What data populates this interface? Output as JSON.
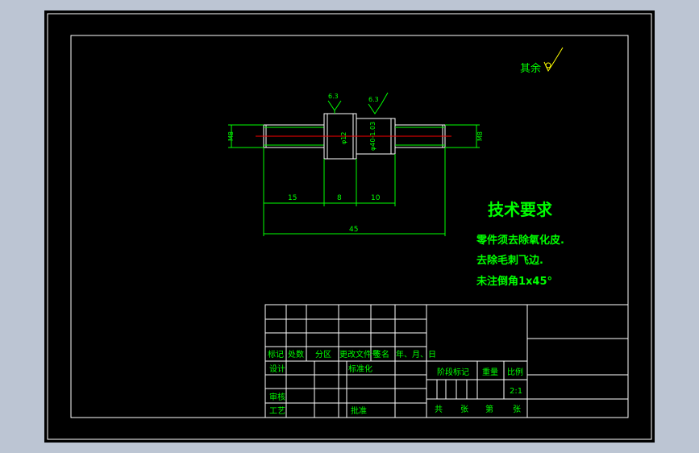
{
  "colors": {
    "background": "#bcc5d3",
    "sheet": "#000000",
    "lines": "#ffffff",
    "text": "#00ff00",
    "dims": "#00ff00",
    "centerline": "#ff0000",
    "roughness": "#ffff00"
  },
  "roughness_default": {
    "label": "其余"
  },
  "roughness_marks": [
    "6.3",
    "6.3"
  ],
  "part_labels": {
    "left_thread": "M8",
    "right_thread": "M8",
    "collar_dia": "φ12",
    "neck_dia": "φ40-1.03"
  },
  "dimensions": {
    "d1": "15",
    "d2": "8",
    "d3": "10",
    "total": "45"
  },
  "tech_req": {
    "title": "技术要求",
    "lines": [
      "零件须去除氧化皮.",
      "去除毛刺飞边.",
      "未注倒角1x45°"
    ]
  },
  "title_block": {
    "rev_headers": [
      "标记",
      "处数",
      "分区",
      "更改文件号",
      "签名",
      "年、月、日"
    ],
    "design": "设计",
    "standard": "标准化",
    "review": "审核",
    "process": "工艺",
    "approve": "批准",
    "stage_mark": "阶段标记",
    "weight": "重量",
    "scale_label": "比例",
    "scale_value": "2:1",
    "sheets_total": "共",
    "sheet_word": "张",
    "sheet_no": "第",
    "sheet_word2": "张"
  }
}
